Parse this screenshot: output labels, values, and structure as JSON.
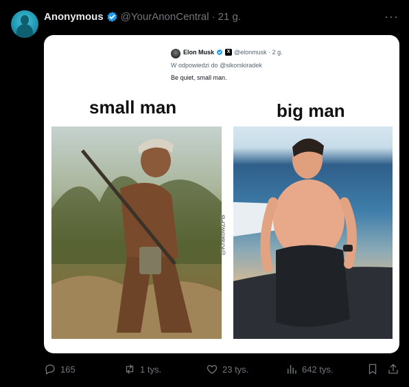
{
  "tweet": {
    "author_name": "Anonymous",
    "handle": "@YourAnonCentral",
    "separator": "·",
    "time": "21 g.",
    "more_label": "···"
  },
  "embedded": {
    "author_name": "Elon Musk",
    "x_badge": "X",
    "meta": "@elonmusk · 2 g.",
    "reply_prefix": "W odpowiedzi do",
    "reply_handle": "@sikorskiradek",
    "text": "Be quiet, small man."
  },
  "meme": {
    "left_caption": "small man",
    "right_caption": "big man",
    "watermark": "@KrakowZPB"
  },
  "actions": {
    "replies": "165",
    "reposts": "1 tys.",
    "likes": "23 tys.",
    "views": "642 tys."
  },
  "colors": {
    "verified": "#1d9bf0",
    "background": "#000000",
    "muted": "#71767b"
  }
}
